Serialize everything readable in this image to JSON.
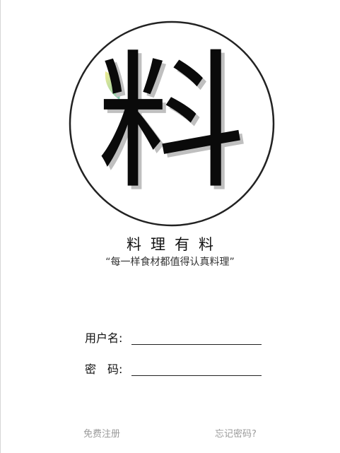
{
  "logo": {
    "character": "料",
    "leaf_gradient": [
      "#f0ec92",
      "#7ec9b0"
    ]
  },
  "app": {
    "name": "料理有料",
    "slogan": "“每一样食材都值得认真料理”"
  },
  "form": {
    "username_label": "用户名:",
    "username_value": "",
    "password_label": "密　码:",
    "password_value": ""
  },
  "links": {
    "register": "免费注册",
    "forgot_password": "忘记密码?"
  }
}
